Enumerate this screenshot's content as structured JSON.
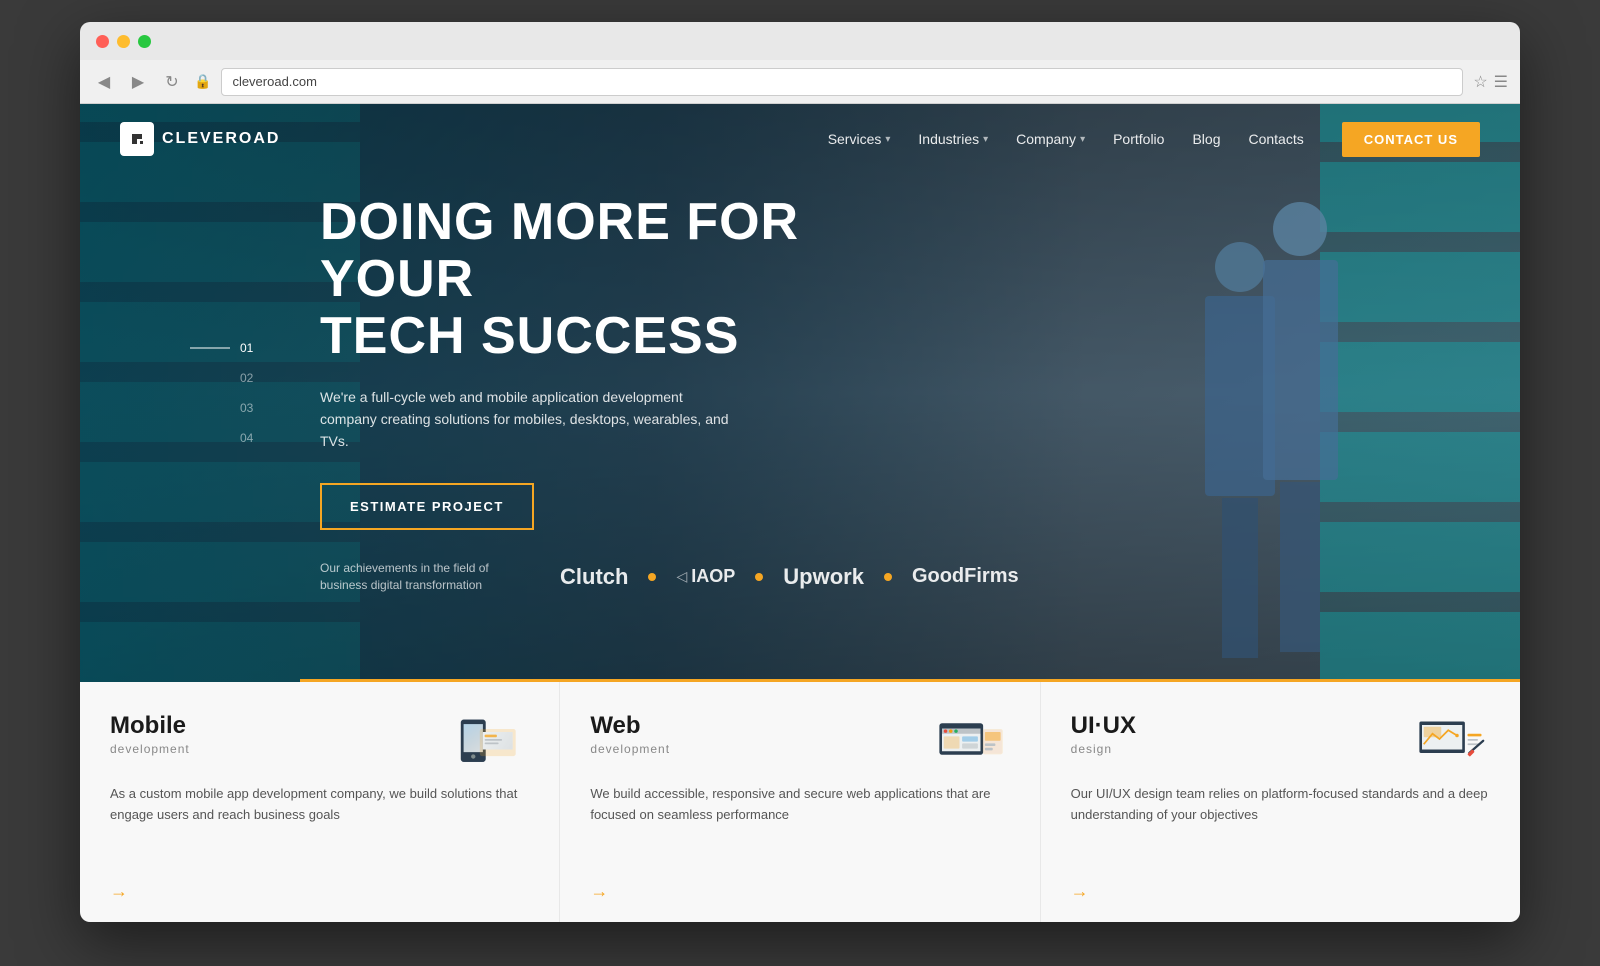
{
  "browser": {
    "address": "cleveroad.com",
    "back_label": "◀",
    "forward_label": "▶",
    "reload_label": "↻",
    "ssl_icon": "🔒",
    "bookmark_icon": "☆",
    "menu_icon": "☰"
  },
  "nav": {
    "logo_letter": "C",
    "logo_text": "CLEVEROAD",
    "items": [
      {
        "label": "Services",
        "has_dropdown": true
      },
      {
        "label": "Industries",
        "has_dropdown": true
      },
      {
        "label": "Company",
        "has_dropdown": true
      },
      {
        "label": "Portfolio",
        "has_dropdown": false
      },
      {
        "label": "Blog",
        "has_dropdown": false
      },
      {
        "label": "Contacts",
        "has_dropdown": false
      }
    ],
    "contact_btn": "CONTACT US"
  },
  "hero": {
    "slide_numbers": [
      "01",
      "02",
      "03",
      "04"
    ],
    "active_slide": 0,
    "headline_line1": "DOING MORE FOR YOUR",
    "headline_line2": "TECH SUCCESS",
    "subtext": "We're a full-cycle web and mobile application development company creating solutions for mobiles, desktops, wearables, and TVs.",
    "cta_label": "ESTIMATE PROJECT",
    "partners_label": "Our achievements in the field of business digital transformation",
    "partners": [
      "Clutch",
      "IAOP",
      "Upwork",
      "GoodFirms"
    ]
  },
  "services": [
    {
      "title": "Mobile",
      "subtitle": "development",
      "description": "As a custom mobile app development company, we build solutions that engage users and reach business goals",
      "arrow": "→"
    },
    {
      "title": "Web",
      "subtitle": "development",
      "description": "We build accessible, responsive and secure web applications that are focused on seamless performance",
      "arrow": "→"
    },
    {
      "title": "UI·UX",
      "subtitle": "design",
      "description": "Our UI/UX design team relies on platform-focused standards and a deep understanding of your objectives",
      "arrow": "→"
    }
  ],
  "colors": {
    "accent": "#f5a623",
    "dark": "#1a1a1a",
    "text_muted": "#888888",
    "hero_overlay": "rgba(20,35,45,0.55)"
  }
}
